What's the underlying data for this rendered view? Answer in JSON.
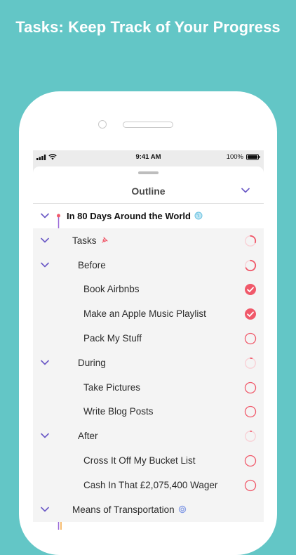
{
  "headline": "Tasks: Keep Track of Your Progress",
  "status_bar": {
    "time": "9:41 AM",
    "battery": "100%"
  },
  "nav": {
    "title": "Outline"
  },
  "outline": [
    {
      "label": "In 80 Days Around the World",
      "level": 0,
      "collapsible": true,
      "icon": "globe-icon",
      "status": "none"
    },
    {
      "label": "Tasks",
      "level": 1,
      "collapsible": true,
      "icon": "pushpin-icon",
      "status": "progress",
      "progress": 0.3
    },
    {
      "label": "Before",
      "level": 2,
      "collapsible": true,
      "icon": "",
      "status": "progress",
      "progress": 0.67
    },
    {
      "label": "Book Airbnbs",
      "level": 3,
      "collapsible": false,
      "icon": "",
      "status": "done"
    },
    {
      "label": "Make an Apple Music Playlist",
      "level": 3,
      "collapsible": false,
      "icon": "",
      "status": "done"
    },
    {
      "label": "Pack My Stuff",
      "level": 3,
      "collapsible": false,
      "icon": "",
      "status": "open"
    },
    {
      "label": "During",
      "level": 2,
      "collapsible": true,
      "icon": "",
      "status": "progress",
      "progress": 0.05
    },
    {
      "label": "Take Pictures",
      "level": 3,
      "collapsible": false,
      "icon": "",
      "status": "open"
    },
    {
      "label": "Write Blog Posts",
      "level": 3,
      "collapsible": false,
      "icon": "",
      "status": "open"
    },
    {
      "label": "After",
      "level": 2,
      "collapsible": true,
      "icon": "",
      "status": "progress",
      "progress": 0.03
    },
    {
      "label": "Cross It Off My Bucket List",
      "level": 3,
      "collapsible": false,
      "icon": "",
      "status": "open"
    },
    {
      "label": "Cash In That £2,075,400 Wager",
      "level": 3,
      "collapsible": false,
      "icon": "",
      "status": "open"
    },
    {
      "label": "Means of Transportation",
      "level": 1,
      "collapsible": true,
      "icon": "ring-icon",
      "status": "none"
    }
  ],
  "colors": {
    "background": "#63c6c6",
    "accent_red": "#f0596a",
    "accent_purple": "#7b5bd3",
    "accent_orange": "#f4a640",
    "chevron": "#6a58c6"
  }
}
